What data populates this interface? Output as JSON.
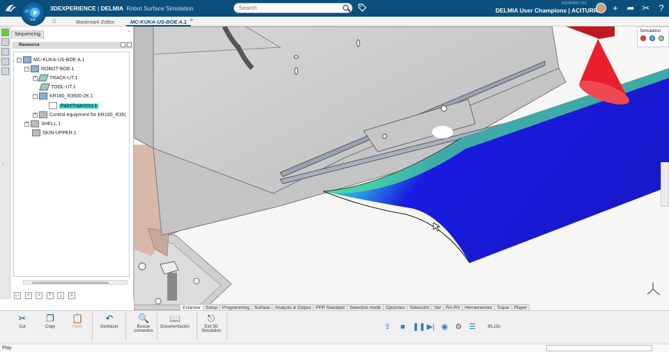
{
  "header": {
    "brand": "3DEXPERIENCE",
    "separator": " | ",
    "product": "DELMIA",
    "app_name": "Robot Surface Simulation",
    "compass_3d": "3D",
    "compass_version": "V.R",
    "search_placeholder": "Search",
    "user_org": "EQUIPADO CIS",
    "user_line": "DELMIA User Champions | ACITURRI",
    "icons": [
      "3ds-logo-icon",
      "compass-icon",
      "tag-icon",
      "user-avatar",
      "add-icon",
      "share-icon",
      "tools-icon",
      "help-icon"
    ]
  },
  "tabs": {
    "items": [
      "Bookmark Editor",
      "MC-KUKA-US-BOE A.1"
    ],
    "active": "MC-KUKA-US-BOE A.1",
    "add": "+"
  },
  "panel": {
    "tab": "Sequencing",
    "collapse": "‹",
    "header": "Resource",
    "tree": [
      {
        "label": "MC-KUKA-US-BOE A.1",
        "level": 0
      },
      {
        "label": "ROBOT-BOE.1",
        "level": 1
      },
      {
        "label": "TRACK-UT.1",
        "level": 2
      },
      {
        "label": "TOOL-UT.1",
        "level": 2
      },
      {
        "label": "KR180_R3500-2K.1",
        "level": 2
      },
      {
        "label": "PaintTrajectory.1",
        "level": 3,
        "selected": true
      },
      {
        "label": "Control equipment for KR180_R35(",
        "level": 2
      },
      {
        "label": "SHELL.1",
        "level": 1
      },
      {
        "label": "SKIN-UPPER.1",
        "level": 1
      }
    ]
  },
  "simulation_panel": {
    "label": "Simulation"
  },
  "command_tabs": {
    "items": [
      "Estándar",
      "Setup",
      "Programming",
      "Surface",
      "Analysis & Output",
      "PPR Standard",
      "Selection mode",
      "Opciones",
      "Selección",
      "Ver",
      "RA-RV",
      "Herramientas",
      "Toque",
      "Player"
    ],
    "active": "Estándar"
  },
  "action_bar": {
    "buttons": [
      {
        "label": "Cut",
        "icon": "scissors-icon",
        "enabled": true
      },
      {
        "label": "Copy",
        "icon": "copy-icon",
        "enabled": true
      },
      {
        "label": "Paste",
        "icon": "paste-icon",
        "enabled": false
      },
      {
        "label": "Deshacer",
        "icon": "undo-icon",
        "enabled": true
      },
      {
        "label": "Buscar comandos",
        "icon": "search-commands-icon",
        "enabled": true
      },
      {
        "label": "Documentación",
        "icon": "book-icon",
        "enabled": true
      },
      {
        "label": "Exit 3D Simulation",
        "icon": "exit-simulation-icon",
        "enabled": true
      }
    ],
    "player_controls": [
      "export-icon",
      "stop-icon",
      "pause-icon",
      "step-forward-icon",
      "speed-icon",
      "settings-icon",
      "list-icon"
    ],
    "time": "85,23s"
  },
  "status": {
    "text": "Play"
  },
  "colors": {
    "topbar": "#0b4f7c",
    "selection": "#2dd3c6",
    "surface_blue": "#1a1ae0",
    "surface_green": "#33e07a",
    "cone_red": "#e8202c"
  }
}
